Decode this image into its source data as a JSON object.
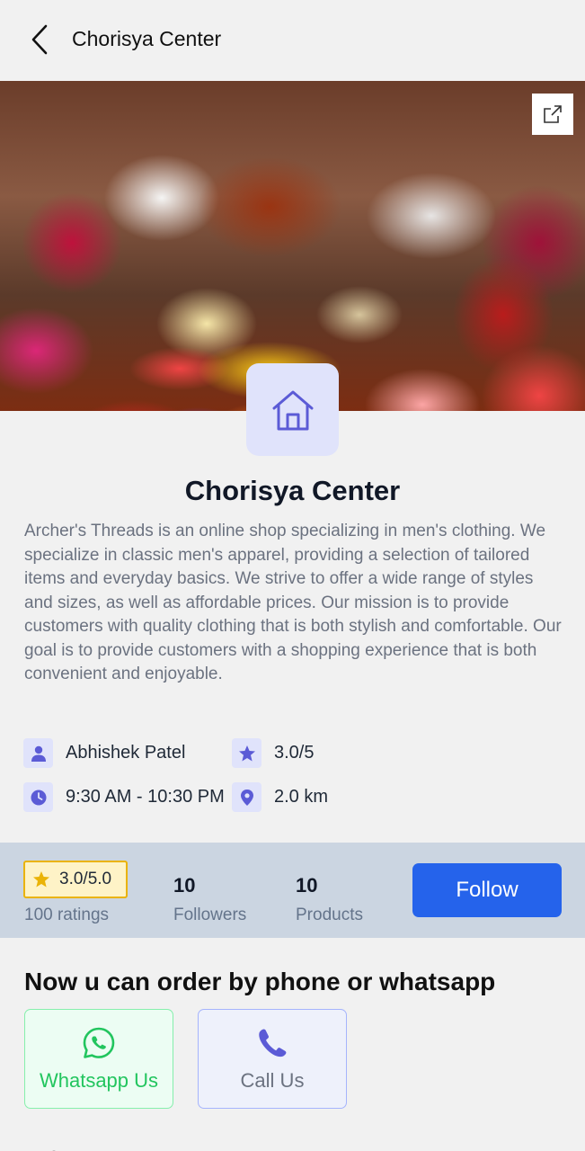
{
  "header": {
    "title": "Chorisya Center"
  },
  "store": {
    "name": "Chorisya Center",
    "description": "Archer's Threads is an online shop specializing in men's clothing. We specialize in classic men's apparel, providing a selection of tailored items and everyday basics. We strive to offer a wide range of styles and sizes, as well as affordable prices. Our mission is to provide customers with quality clothing that is both stylish and comfortable. Our goal is to provide customers with a shopping experience that is both convenient and enjoyable.",
    "owner": "Abhishek Patel",
    "rating": "3.0/5",
    "hours": "9:30 AM - 10:30 PM",
    "distance": "2.0 km"
  },
  "stats": {
    "rating_badge": "3.0/5.0",
    "ratings_count": "100 ratings",
    "followers_count": "10",
    "followers_label": "Followers",
    "products_count": "10",
    "products_label": "Products",
    "follow_label": "Follow"
  },
  "order": {
    "heading": "Now u can order by phone or whatsapp",
    "whatsapp_label": "Whatsapp Us",
    "call_label": "Call Us"
  },
  "colors": {
    "accent": "#2563eb",
    "icon_bg": "#e0e3fb",
    "icon_fg": "#5b5bd6",
    "stats_bg": "#cbd5e1",
    "whatsapp": "#22c55e",
    "star": "#eab308"
  },
  "icons": {
    "back": "chevron-left-icon",
    "share": "share-icon",
    "store": "home-icon",
    "owner": "person-icon",
    "rating": "star-icon",
    "hours": "clock-icon",
    "distance": "location-pin-icon",
    "whatsapp": "whatsapp-icon",
    "call": "phone-icon"
  }
}
